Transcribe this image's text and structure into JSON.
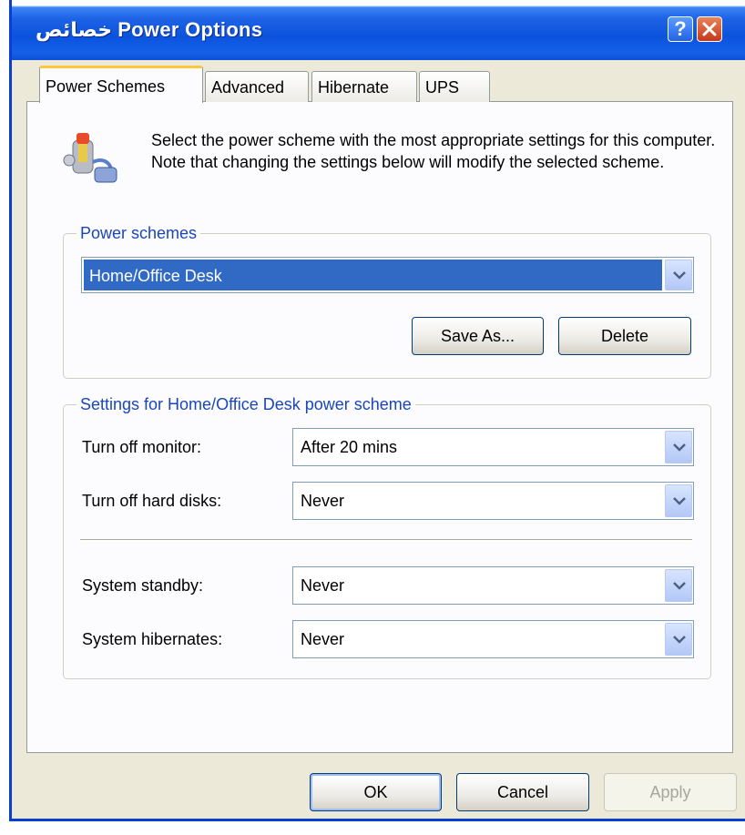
{
  "window": {
    "title": "خصائص Power Options"
  },
  "tabs": [
    {
      "label": "Power Schemes"
    },
    {
      "label": "Advanced"
    },
    {
      "label": "Hibernate"
    },
    {
      "label": "UPS"
    }
  ],
  "description": "Select the power scheme with the most appropriate settings for this computer. Note that changing the settings below will modify the selected scheme.",
  "power_schemes": {
    "group_title": "Power schemes",
    "selected": "Home/Office Desk",
    "save_as_label": "Save As...",
    "delete_label": "Delete"
  },
  "settings": {
    "group_title": "Settings for Home/Office Desk power scheme",
    "rows": [
      {
        "label": "Turn off monitor:",
        "value": "After 20 mins"
      },
      {
        "label": "Turn off hard disks:",
        "value": "Never"
      },
      {
        "label": "System standby:",
        "value": "Never"
      },
      {
        "label": "System hibernates:",
        "value": "Never"
      }
    ]
  },
  "buttons": {
    "ok": "OK",
    "cancel": "Cancel",
    "apply": "Apply"
  },
  "icons": {
    "help": "help-icon",
    "close": "close-icon",
    "info": "power-options-icon",
    "dropdown": "chevron-down-icon"
  },
  "colors": {
    "titlebar": "#0b53dd",
    "selection": "#316ac5",
    "tab_active_accent": "#ffc83c"
  }
}
